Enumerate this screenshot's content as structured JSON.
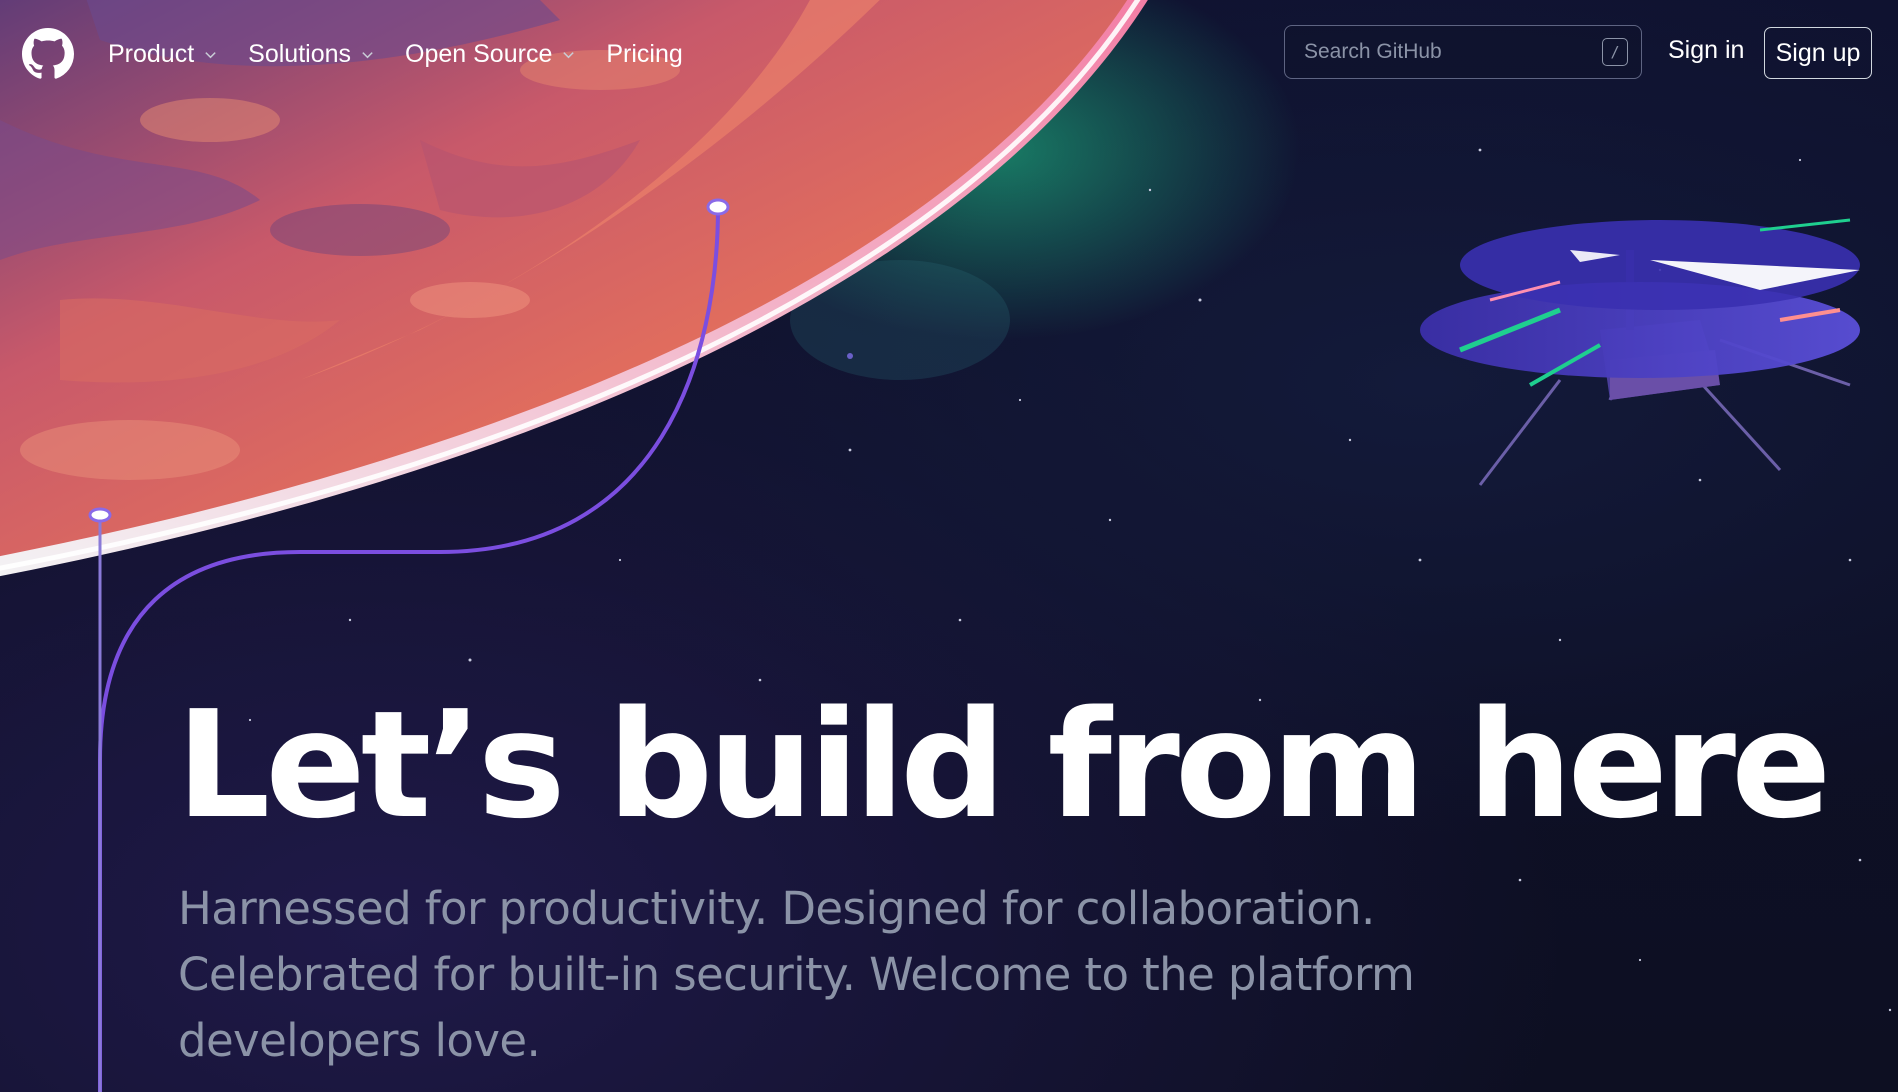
{
  "header": {
    "logo_icon": "github-mark-icon",
    "nav": [
      {
        "label": "Product",
        "has_dropdown": true
      },
      {
        "label": "Solutions",
        "has_dropdown": true
      },
      {
        "label": "Open Source",
        "has_dropdown": true
      },
      {
        "label": "Pricing",
        "has_dropdown": false
      }
    ],
    "search": {
      "placeholder": "Search GitHub",
      "shortcut_key": "/"
    },
    "sign_in_label": "Sign in",
    "sign_up_label": "Sign up"
  },
  "hero": {
    "title": "Let’s build from here",
    "subtitle": "Harnessed for productivity. Designed for collaboration. Celebrated for built-in security. Welcome to the platform developers love."
  },
  "illustration": {
    "planet_icon": "planet-illustration",
    "drone_icon": "helicopter-drone-illustration",
    "colors": {
      "background": "#0d1117",
      "planet": "#e8735a",
      "planet_rim": "#ff8fb0",
      "glow_green": "#1fcf8f",
      "path_line": "#7b4ee0"
    }
  }
}
